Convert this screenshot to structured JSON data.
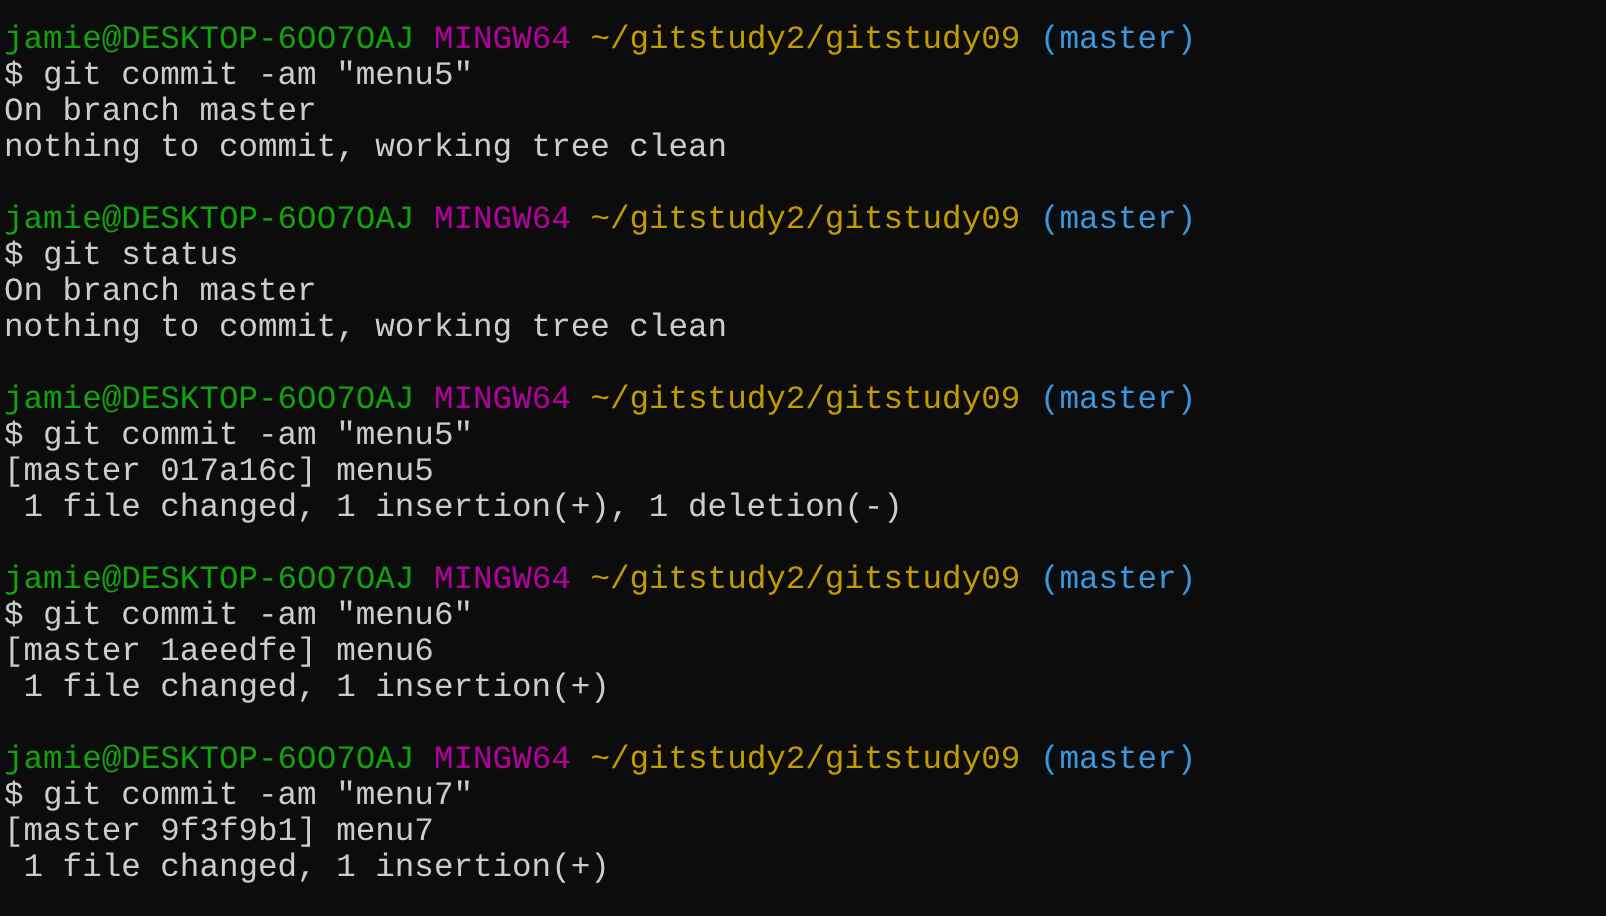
{
  "terminal": {
    "blocks": [
      {
        "prompt": {
          "user_host": "jamie@DESKTOP-6OO7OAJ",
          "system": "MINGW64",
          "path": "~/gitstudy2/gitstudy09",
          "branch": "(master)"
        },
        "command": "$ git commit -am \"menu5\"",
        "output": [
          "On branch master",
          "nothing to commit, working tree clean"
        ]
      },
      {
        "prompt": {
          "user_host": "jamie@DESKTOP-6OO7OAJ",
          "system": "MINGW64",
          "path": "~/gitstudy2/gitstudy09",
          "branch": "(master)"
        },
        "command": "$ git status",
        "output": [
          "On branch master",
          "nothing to commit, working tree clean"
        ]
      },
      {
        "prompt": {
          "user_host": "jamie@DESKTOP-6OO7OAJ",
          "system": "MINGW64",
          "path": "~/gitstudy2/gitstudy09",
          "branch": "(master)"
        },
        "command": "$ git commit -am \"menu5\"",
        "output": [
          "[master 017a16c] menu5",
          " 1 file changed, 1 insertion(+), 1 deletion(-)"
        ]
      },
      {
        "prompt": {
          "user_host": "jamie@DESKTOP-6OO7OAJ",
          "system": "MINGW64",
          "path": "~/gitstudy2/gitstudy09",
          "branch": "(master)"
        },
        "command": "$ git commit -am \"menu6\"",
        "output": [
          "[master 1aeedfe] menu6",
          " 1 file changed, 1 insertion(+)"
        ]
      },
      {
        "prompt": {
          "user_host": "jamie@DESKTOP-6OO7OAJ",
          "system": "MINGW64",
          "path": "~/gitstudy2/gitstudy09",
          "branch": "(master)"
        },
        "command": "$ git commit -am \"menu7\"",
        "output": [
          "[master 9f3f9b1] menu7",
          " 1 file changed, 1 insertion(+)"
        ]
      }
    ]
  }
}
